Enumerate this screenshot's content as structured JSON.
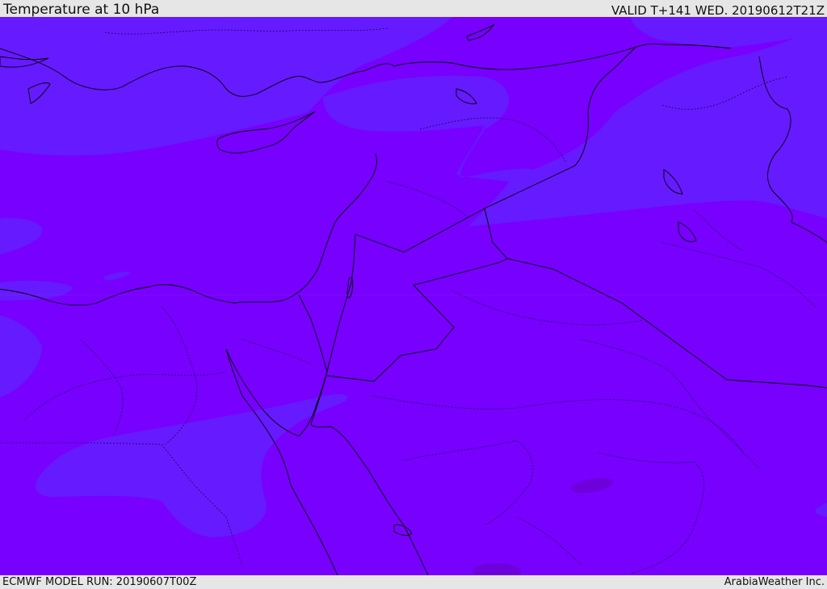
{
  "header": {
    "title": "Temperature at 10 hPa",
    "valid": "VALID T+141 WED. 20190612T21Z"
  },
  "footer": {
    "model_run": "ECMWF MODEL RUN: 20190607T00Z",
    "credit": "ArabiaWeather Inc."
  },
  "map": {
    "base_color": "#7700ff",
    "cooler_color": "#661aff",
    "warmer_color": "#6a00cc",
    "coastline_color": "#000000",
    "border_color": "#1a0040"
  }
}
